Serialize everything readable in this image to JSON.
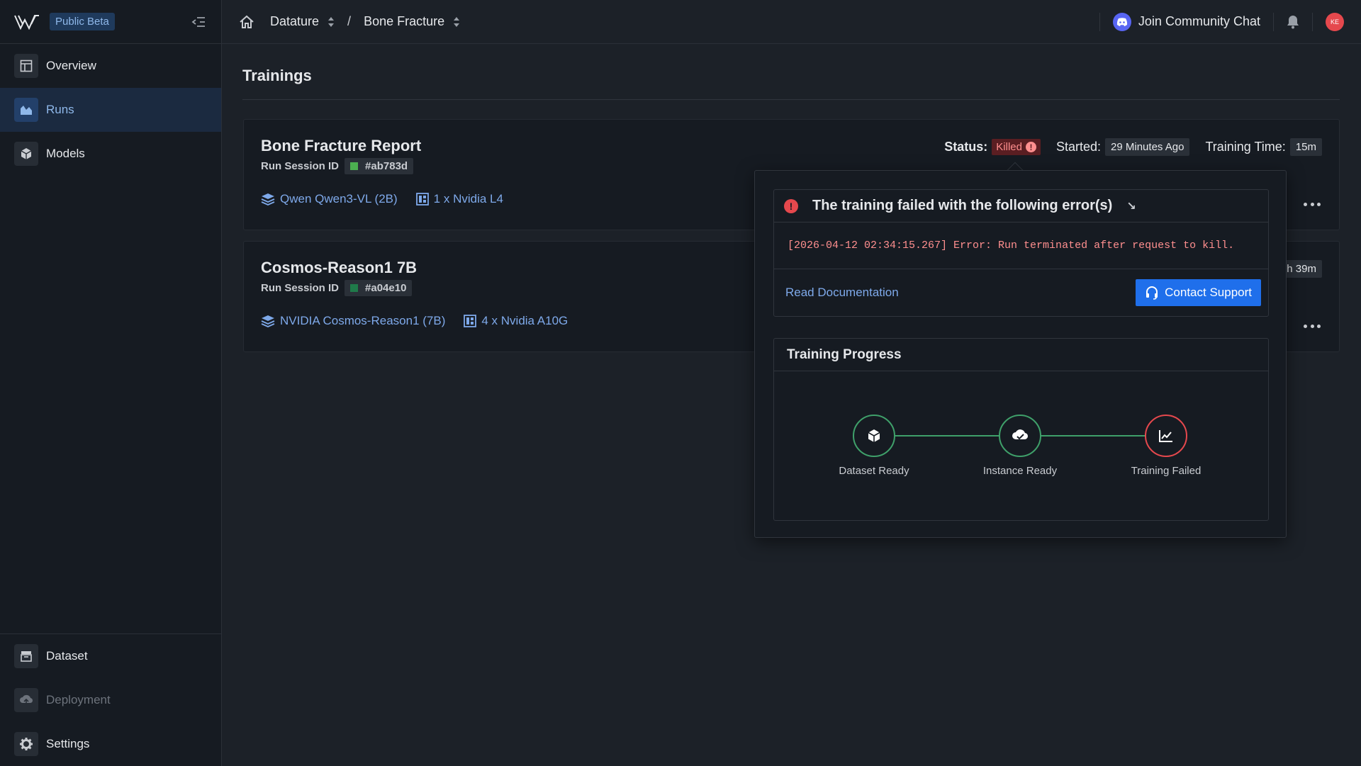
{
  "sidebar": {
    "badge": "Public Beta",
    "items": [
      {
        "label": "Overview",
        "icon": "overview-icon"
      },
      {
        "label": "Runs",
        "icon": "runs-icon"
      },
      {
        "label": "Models",
        "icon": "models-icon"
      }
    ],
    "bottom_items": [
      {
        "label": "Dataset",
        "icon": "dataset-icon"
      },
      {
        "label": "Deployment",
        "icon": "deployment-icon"
      },
      {
        "label": "Settings",
        "icon": "gear-icon"
      }
    ]
  },
  "topbar": {
    "crumbs": [
      "Datature",
      "Bone Fracture"
    ],
    "separator": "/",
    "community": "Join Community Chat",
    "avatar_initials": "KE"
  },
  "page": {
    "title": "Trainings"
  },
  "runs": [
    {
      "title": "Bone Fracture Report",
      "session_label": "Run Session ID",
      "session_id": "#ab783d",
      "session_color": "#4caf50",
      "model": "Qwen Qwen3-VL (2B)",
      "instance": "1 x Nvidia L4",
      "status_label": "Status:",
      "status": "Killed",
      "started_label": "Started:",
      "started": "29 Minutes Ago",
      "time_label": "Training Time:",
      "time": "15m"
    },
    {
      "title": "Cosmos-Reason1 7B",
      "session_label": "Run Session ID",
      "session_id": "#a04e10",
      "session_color": "#1f7a4a",
      "model": "NVIDIA Cosmos-Reason1 (7B)",
      "instance": "4 x Nvidia A10G",
      "time_partial": "h 39m"
    }
  ],
  "popover": {
    "error_title": "The training failed with the following error(s)",
    "error_message": "[2026-04-12 02:34:15.267] Error: Run terminated after request to kill.",
    "doc_link": "Read Documentation",
    "support_button": "Contact Support",
    "progress_title": "Training Progress",
    "steps": [
      {
        "label": "Dataset Ready",
        "state": "done"
      },
      {
        "label": "Instance Ready",
        "state": "done"
      },
      {
        "label": "Training Failed",
        "state": "failed"
      }
    ]
  },
  "colors": {
    "accent": "#1f6feb",
    "link": "#7ea9ea",
    "error": "#e5484d",
    "success": "#3fa06a"
  }
}
